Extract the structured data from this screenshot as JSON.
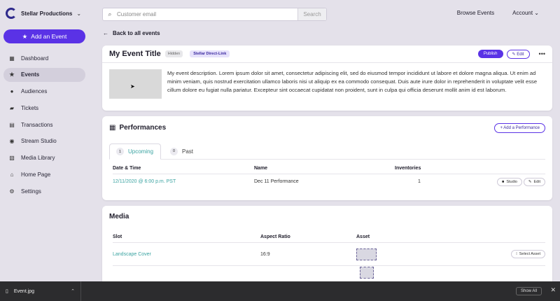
{
  "brand": {
    "name": "Stellar Productions"
  },
  "search": {
    "placeholder": "Customer email",
    "button": "Search"
  },
  "topnav": {
    "browse": "Browse Events",
    "account": "Account"
  },
  "sidebar": {
    "add_event": "Add an Event",
    "items": [
      {
        "label": "Dashboard",
        "icon": "dashboard-icon"
      },
      {
        "label": "Events",
        "icon": "star-icon",
        "active": true
      },
      {
        "label": "Audiences",
        "icon": "users-icon"
      },
      {
        "label": "Tickets",
        "icon": "ticket-icon"
      },
      {
        "label": "Transactions",
        "icon": "transactions-icon"
      },
      {
        "label": "Stream Studio",
        "icon": "stream-icon"
      },
      {
        "label": "Media Library",
        "icon": "media-icon"
      },
      {
        "label": "Home Page",
        "icon": "home-icon"
      },
      {
        "label": "Settings",
        "icon": "gear-icon"
      }
    ]
  },
  "back_label": "Back to all events",
  "event": {
    "title": "My Event Title",
    "hidden_badge": "Hidden",
    "link_badge": "Stellar Direct-Link",
    "publish": "Publish",
    "edit": "Edit",
    "description": "My event description. Lorem ipsum dolor sit amet, consectetur adipiscing elit, sed do eiusmod tempor incididunt ut labore et dolore magna aliqua. Ut enim ad minim veniam, quis nostrud exercitation ullamco laboris nisi ut aliquip ex ea commodo consequat. Duis aute irure dolor in reprehenderit in voluptate velit esse cillum dolore eu fugiat nulla pariatur. Excepteur sint occaecat cupidatat non proident, sunt in culpa qui officia deserunt mollit anim id est laborum."
  },
  "performances": {
    "title": "Performances",
    "add_button": "+ Add a Performance",
    "tabs": [
      {
        "count": "1",
        "label": "Upcoming"
      },
      {
        "count": "0",
        "label": "Past"
      }
    ],
    "columns": {
      "date": "Date & Time",
      "name": "Name",
      "inventories": "Inventories"
    },
    "rows": [
      {
        "date": "12/11/2020 @ 6:00 p.m. PST",
        "name": "Dec 11 Performance",
        "inventories": "1",
        "studio": "Studio",
        "edit": "Edit"
      }
    ]
  },
  "media": {
    "title": "Media",
    "columns": {
      "slot": "Slot",
      "ratio": "Aspect Ratio",
      "asset": "Asset"
    },
    "rows": [
      {
        "slot": "Landscape Cover",
        "ratio": "16:9",
        "action": "Select Asset"
      }
    ]
  },
  "downloads": {
    "file": "Event.jpg",
    "show_all": "Show All"
  },
  "colors": {
    "accent": "#5a32e6",
    "link": "#3aa3a1",
    "background": "#e4e1ea"
  }
}
